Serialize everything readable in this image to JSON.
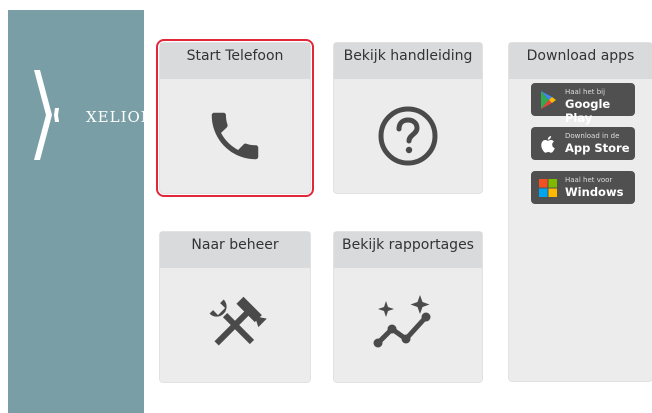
{
  "brand": {
    "logo_text": "XELION"
  },
  "tiles": [
    {
      "label": "Start Telefoon",
      "icon": "phone-icon"
    },
    {
      "label": "Bekijk handleiding",
      "icon": "help-circle-icon"
    },
    {
      "label": "Naar beheer",
      "icon": "tools-icon"
    },
    {
      "label": "Bekijk rapportages",
      "icon": "sparkle-chart-icon"
    }
  ],
  "downloads": {
    "title": "Download apps",
    "buttons": [
      {
        "small": "Haal het bij",
        "large": "Google Play",
        "icon": "google-play-icon"
      },
      {
        "small": "Download in de",
        "large": "App Store",
        "icon": "apple-icon"
      },
      {
        "small": "Haal het voor",
        "large": "Windows",
        "icon": "windows-icon"
      }
    ]
  },
  "colors": {
    "sidebar": "#7a9ea6",
    "selected_outline": "#e0283a",
    "icon": "#4a4a4a"
  }
}
